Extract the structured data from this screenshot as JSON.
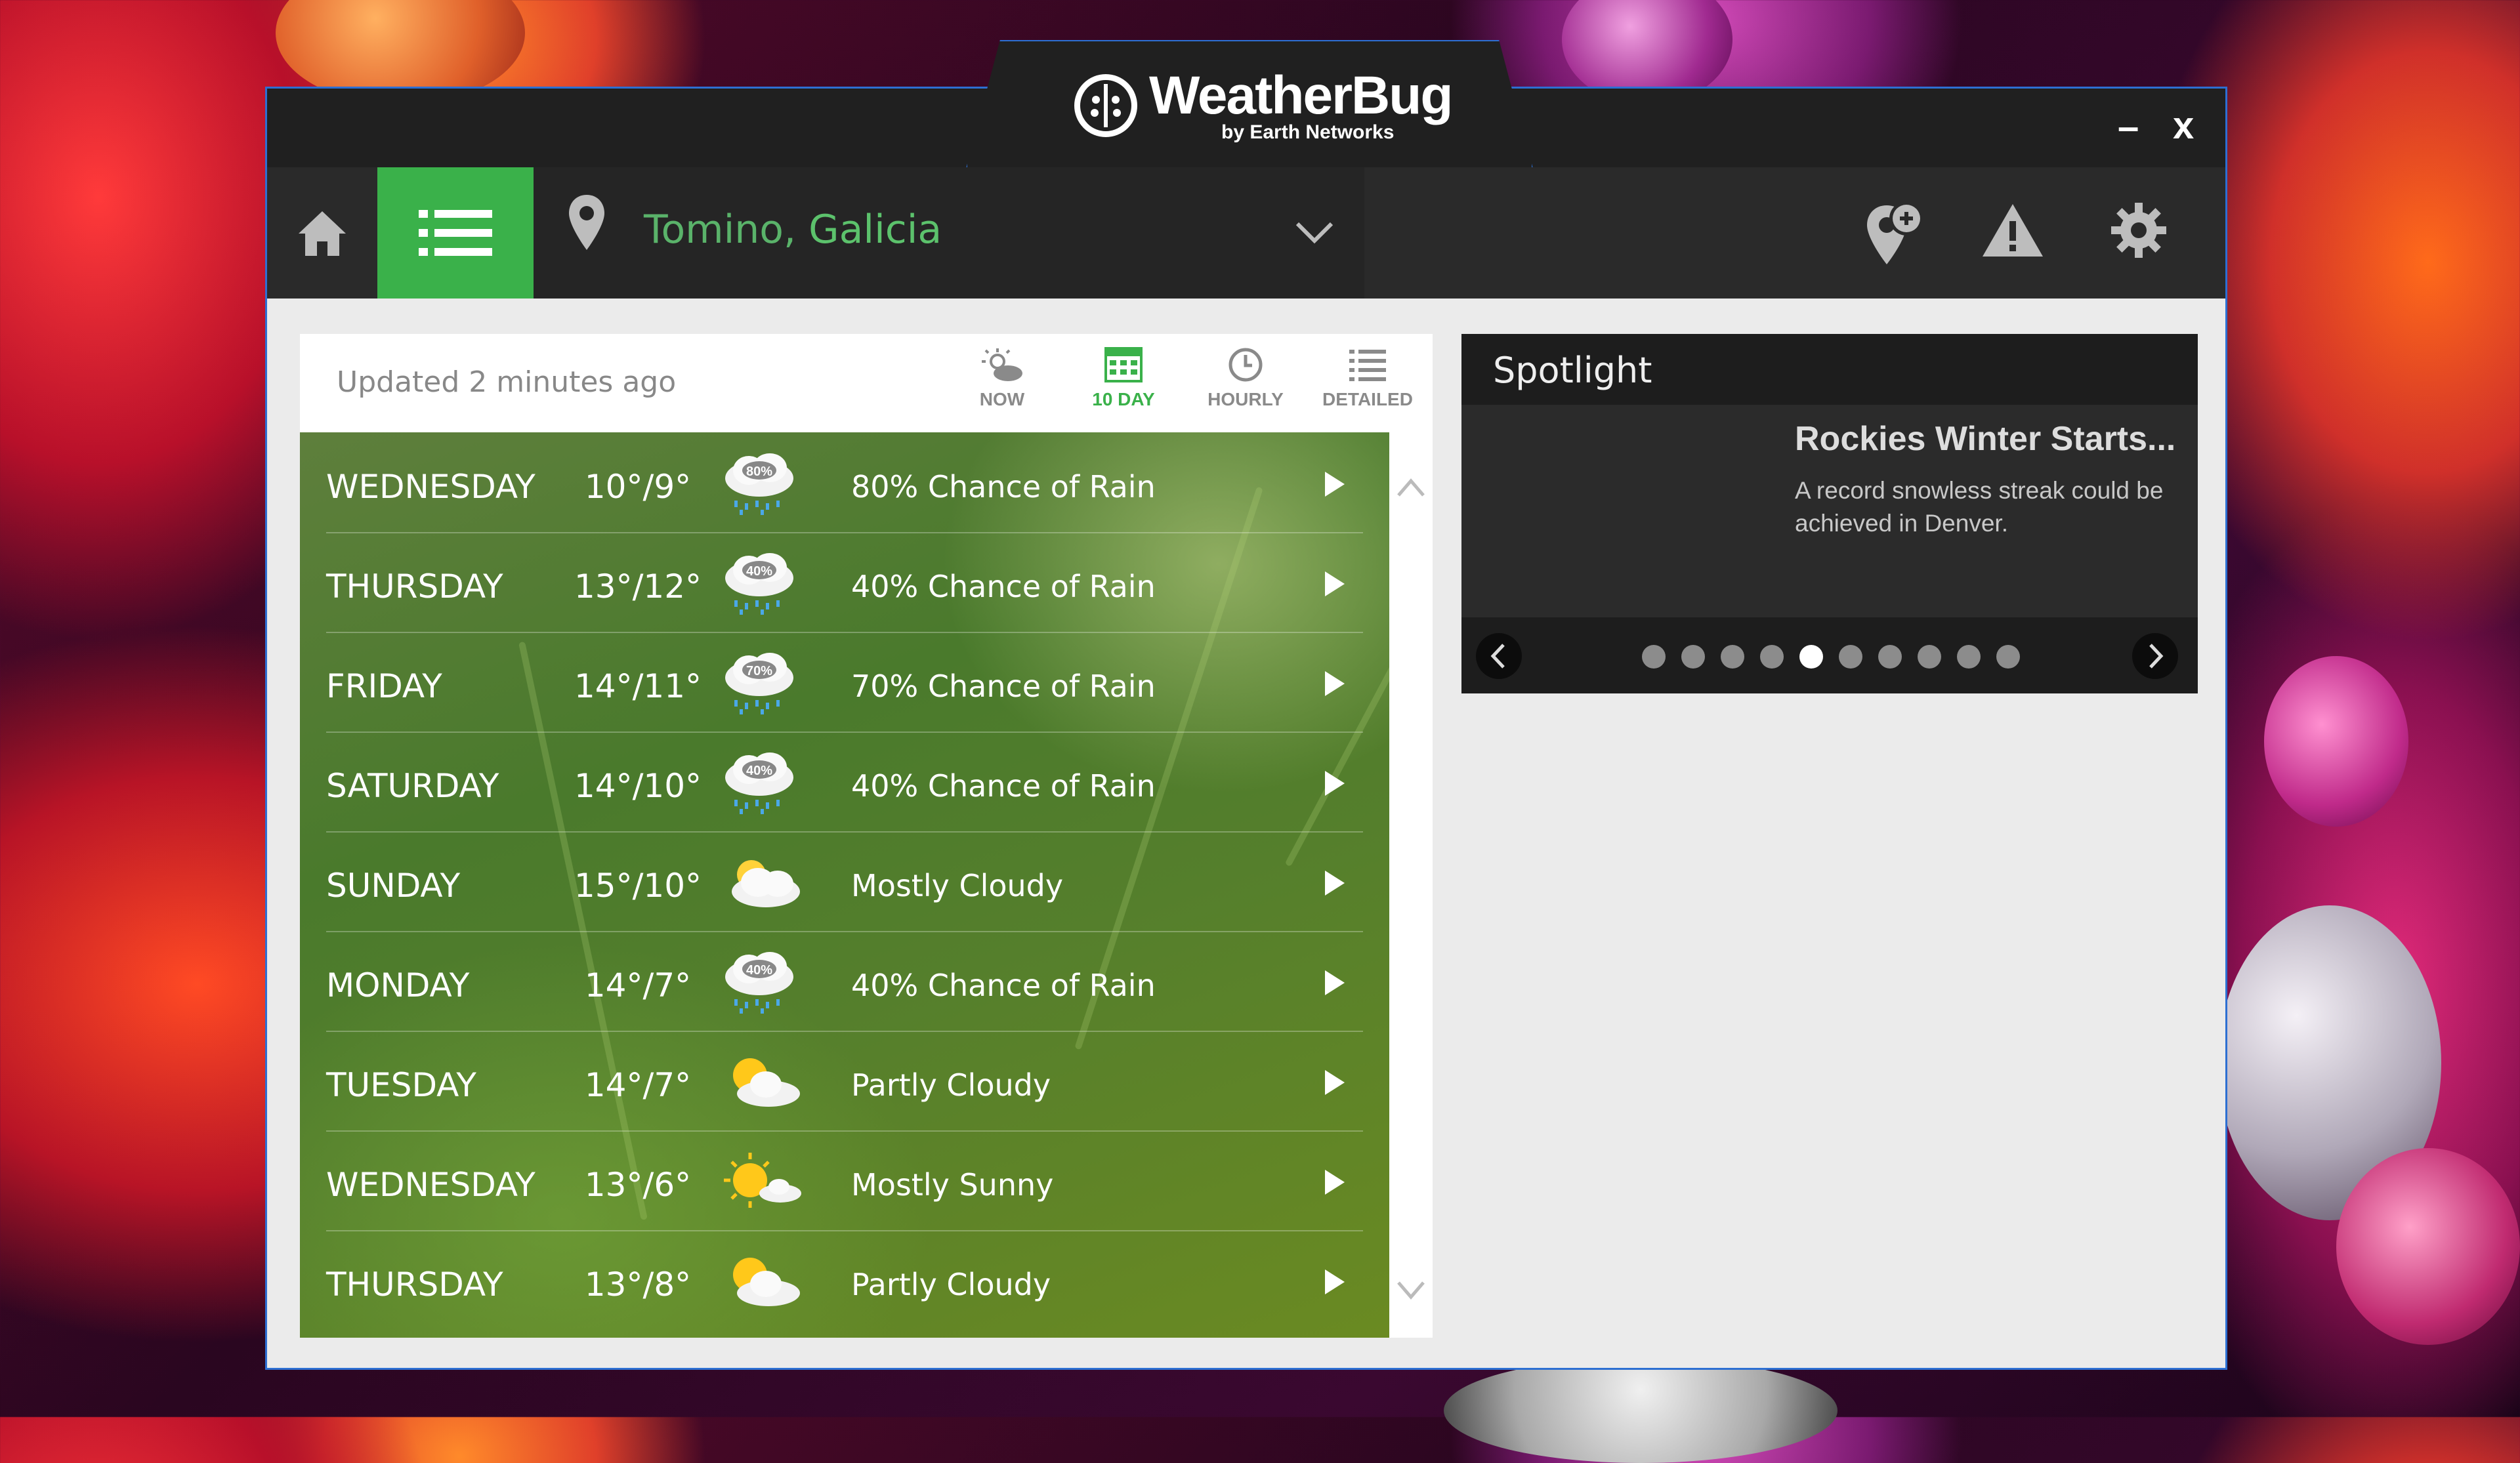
{
  "app": {
    "logo_name": "WeatherBug",
    "logo_sub": "by Earth Networks",
    "minimize": "–",
    "close": "x"
  },
  "toolbar": {
    "location_city": "Tomino,",
    "location_region": "Galicia",
    "icons": [
      "home-icon",
      "list-icon",
      "location-pin-icon",
      "chevron-down-icon",
      "add-location-icon",
      "alert-icon",
      "gear-icon"
    ],
    "accent_color": "#3ab14a"
  },
  "forecast_panel": {
    "updated": "Updated 2 minutes ago",
    "tabs": [
      {
        "label": "NOW",
        "icon": "partly-cloudy-icon"
      },
      {
        "label": "10 DAY",
        "icon": "calendar-icon",
        "active": true
      },
      {
        "label": "HOURLY",
        "icon": "clock-icon"
      },
      {
        "label": "DETAILED",
        "icon": "list-icon"
      }
    ],
    "days": [
      {
        "day": "WEDNESDAY",
        "temp": "10°/9°",
        "icon": "rain-icon",
        "pct": "80%",
        "cond": "80% Chance of Rain"
      },
      {
        "day": "THURSDAY",
        "temp": "13°/12°",
        "icon": "rain-icon",
        "pct": "40%",
        "cond": "40% Chance of Rain"
      },
      {
        "day": "FRIDAY",
        "temp": "14°/11°",
        "icon": "rain-icon",
        "pct": "70%",
        "cond": "70% Chance of Rain"
      },
      {
        "day": "SATURDAY",
        "temp": "14°/10°",
        "icon": "rain-icon",
        "pct": "40%",
        "cond": "40% Chance of Rain"
      },
      {
        "day": "SUNDAY",
        "temp": "15°/10°",
        "icon": "mostly-cloudy-icon",
        "pct": "",
        "cond": "Mostly Cloudy"
      },
      {
        "day": "MONDAY",
        "temp": "14°/7°",
        "icon": "rain-icon",
        "pct": "40%",
        "cond": "40% Chance of Rain"
      },
      {
        "day": "TUESDAY",
        "temp": "14°/7°",
        "icon": "partly-cloudy-icon",
        "pct": "",
        "cond": "Partly Cloudy"
      },
      {
        "day": "WEDNESDAY",
        "temp": "13°/6°",
        "icon": "mostly-sunny-icon",
        "pct": "",
        "cond": "Mostly Sunny"
      },
      {
        "day": "THURSDAY",
        "temp": "13°/8°",
        "icon": "partly-cloudy-icon",
        "pct": "",
        "cond": "Partly Cloudy"
      }
    ]
  },
  "spotlight": {
    "title": "Spotlight",
    "headline": "Rockies Winter Starts...",
    "description": "A record snowless streak could be achieved in Denver.",
    "dot_count": 10,
    "active_dot": 5
  }
}
